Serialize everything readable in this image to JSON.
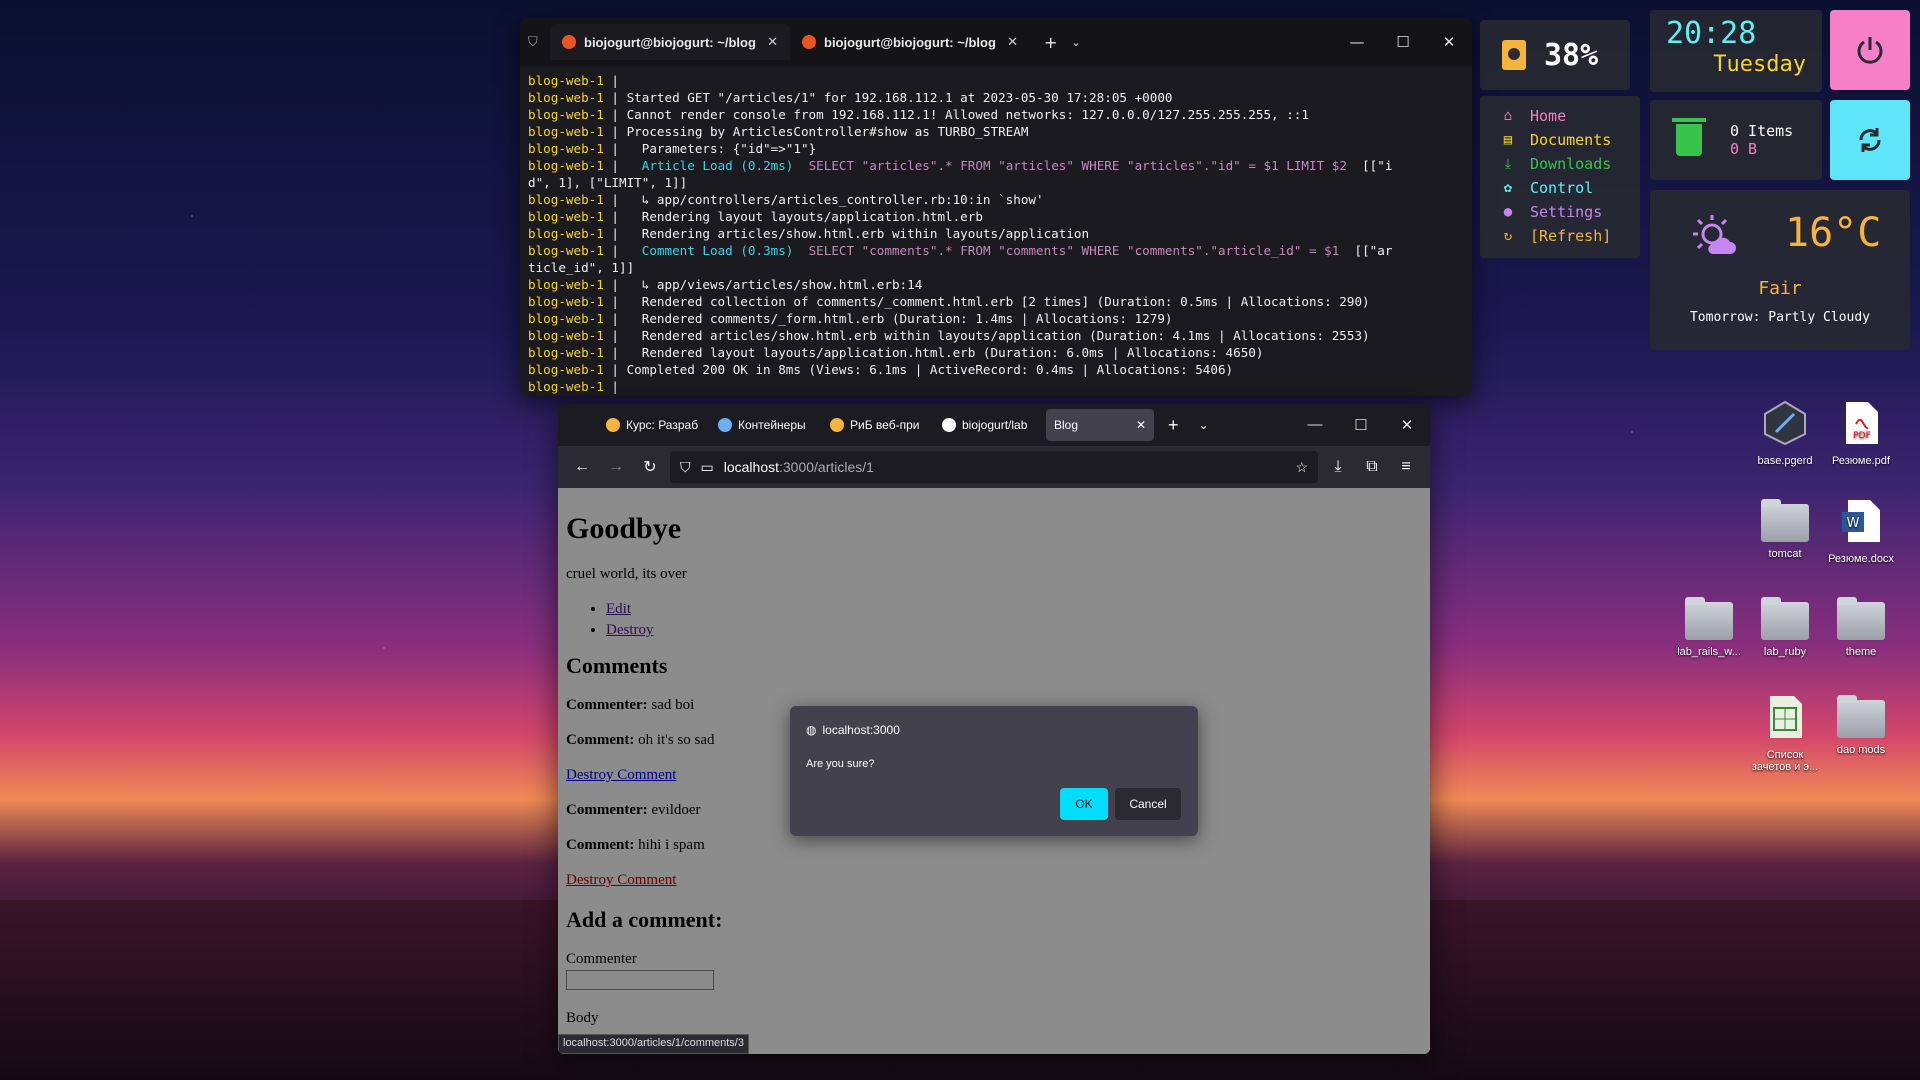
{
  "terminal": {
    "tabs": [
      {
        "title": "biojogurt@biojogurt: ~/blog"
      },
      {
        "title": "biojogurt@biojogurt: ~/blog"
      }
    ],
    "lines": [
      {
        "p": "blog-web-1",
        "t": " |"
      },
      {
        "p": "blog-web-1",
        "t": " | Started GET \"/articles/1\" for 192.168.112.1 at 2023-05-30 17:28:05 +0000"
      },
      {
        "p": "blog-web-1",
        "t": " | Cannot render console from 192.168.112.1! Allowed networks: 127.0.0.0/127.255.255.255, ::1"
      },
      {
        "p": "blog-web-1",
        "t": " | Processing by ArticlesController#show as TURBO_STREAM"
      },
      {
        "p": "blog-web-1",
        "t": " |   Parameters: {\"id\"=>\"1\"}"
      },
      {
        "p": "blog-web-1",
        "t": " |   ",
        "c": "Article Load (0.2ms)",
        "k": "  SELECT \"articles\".* FROM \"articles\" WHERE \"articles\".\"id\" = $1 LIMIT $2",
        "e": "  [[\"i"
      },
      {
        "p": "",
        "t": "d\", 1], [\"LIMIT\", 1]]"
      },
      {
        "p": "blog-web-1",
        "t": " |   ↳ app/controllers/articles_controller.rb:10:in `show'"
      },
      {
        "p": "blog-web-1",
        "t": " |   Rendering layout layouts/application.html.erb"
      },
      {
        "p": "blog-web-1",
        "t": " |   Rendering articles/show.html.erb within layouts/application"
      },
      {
        "p": "blog-web-1",
        "t": " |   ",
        "c": "Comment Load (0.3ms)",
        "k": "  SELECT \"comments\".* FROM \"comments\" WHERE \"comments\".\"article_id\" = $1",
        "e": "  [[\"ar"
      },
      {
        "p": "",
        "t": "ticle_id\", 1]]"
      },
      {
        "p": "blog-web-1",
        "t": " |   ↳ app/views/articles/show.html.erb:14"
      },
      {
        "p": "blog-web-1",
        "t": " |   Rendered collection of comments/_comment.html.erb [2 times] (Duration: 0.5ms | Allocations: 290)"
      },
      {
        "p": "blog-web-1",
        "t": " |   Rendered comments/_form.html.erb (Duration: 1.4ms | Allocations: 1279)"
      },
      {
        "p": "blog-web-1",
        "t": " |   Rendered articles/show.html.erb within layouts/application (Duration: 4.1ms | Allocations: 2553)"
      },
      {
        "p": "blog-web-1",
        "t": " |   Rendered layout layouts/application.html.erb (Duration: 6.0ms | Allocations: 4650)"
      },
      {
        "p": "blog-web-1",
        "t": " | Completed 200 OK in 8ms (Views: 6.1ms | ActiveRecord: 0.4ms | Allocations: 5406)"
      },
      {
        "p": "blog-web-1",
        "t": " |"
      }
    ]
  },
  "widgets": {
    "battery": "38%",
    "menu": [
      {
        "label": "Home",
        "icon": "home-icon",
        "color": "#f77fc8"
      },
      {
        "label": "Documents",
        "icon": "folder-icon",
        "color": "#f5d52b"
      },
      {
        "label": "Downloads",
        "icon": "download-icon",
        "color": "#37c44a"
      },
      {
        "label": "Control",
        "icon": "gear-icon",
        "color": "#5ff0f4"
      },
      {
        "label": "Settings",
        "icon": "drop-icon",
        "color": "#c586f0"
      },
      {
        "label": "[Refresh]",
        "icon": "refresh-icon",
        "color": "#f5b53b"
      }
    ],
    "clock_time": "20:28",
    "clock_day": "Tuesday",
    "trash_items": "0 Items",
    "trash_size": "0 B",
    "weather_temp": "16°C",
    "weather_cond": "Fair",
    "weather_tomorrow": "Tomorrow: Partly Cloudy"
  },
  "desktop": [
    {
      "label": "base.pgerd",
      "kind": "file"
    },
    {
      "label": "Резюме.pdf",
      "kind": "pdf"
    },
    {
      "label": "tomcat",
      "kind": "folder"
    },
    {
      "label": "Резюме.docx",
      "kind": "docx"
    },
    {
      "label": "lab_rails_w...",
      "kind": "folder"
    },
    {
      "label": "lab_ruby",
      "kind": "folder"
    },
    {
      "label": "theme",
      "kind": "folder"
    },
    {
      "label": "Список зачетов и э...",
      "kind": "sheet"
    },
    {
      "label": "dao mods",
      "kind": "folder"
    }
  ],
  "browser": {
    "tabs": [
      {
        "label": "Курс: Разраб",
        "color": "#f5b53b"
      },
      {
        "label": "Контейнеры",
        "color": "#6ab0f3"
      },
      {
        "label": "РиБ веб-при",
        "color": "#f5b53b"
      },
      {
        "label": "biojogurt/lab",
        "color": "#ffffff"
      },
      {
        "label": "Blog",
        "color": ""
      }
    ],
    "url_host": "localhost",
    "url_path": ":3000/articles/1",
    "status_url": "localhost:3000/articles/1/comments/3"
  },
  "article": {
    "title": "Goodbye",
    "body": "cruel world, its over",
    "edit": "Edit",
    "destroy": "Destroy",
    "comments_heading": "Comments",
    "comments": [
      {
        "commenter_label": "Commenter:",
        "commenter": "sad boi",
        "comment_label": "Comment:",
        "comment": "oh it's so sad",
        "destroy": "Destroy Comment"
      },
      {
        "commenter_label": "Commenter:",
        "commenter": "evildoer",
        "comment_label": "Comment:",
        "comment": "hihi i spam",
        "destroy": "Destroy Comment"
      }
    ],
    "add_heading": "Add a comment:",
    "commenter_field": "Commenter",
    "body_field": "Body"
  },
  "dialog": {
    "origin": "localhost:3000",
    "message": "Are you sure?",
    "ok": "OK",
    "cancel": "Cancel"
  }
}
